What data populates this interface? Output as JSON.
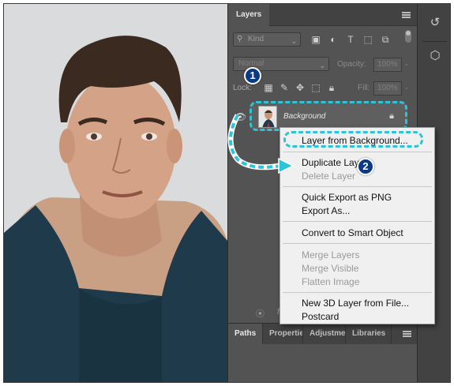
{
  "layers_panel": {
    "tab_label": "Layers",
    "filter": {
      "kind_label": "Kind"
    },
    "blend_mode": "Normal",
    "opacity_label": "Opacity:",
    "opacity_value": "100%",
    "lock_label": "Lock:",
    "fill_label": "Fill:",
    "fill_value": "100%",
    "layer": {
      "name": "Background"
    },
    "footer": {
      "link_glyph": "⦿",
      "fx_label": "fx"
    }
  },
  "bottom_tabs": [
    "Paths",
    "Properties",
    "Adjustments",
    "Libraries"
  ],
  "context_menu": {
    "items": [
      {
        "label": "Layer from Background...",
        "enabled": true
      },
      {
        "label": "Duplicate Layer...",
        "enabled": true
      },
      {
        "label": "Delete Layer",
        "enabled": false
      },
      {
        "label": "Quick Export as PNG",
        "enabled": true
      },
      {
        "label": "Export As...",
        "enabled": true
      },
      {
        "label": "Convert to Smart Object",
        "enabled": true
      },
      {
        "label": "Merge Layers",
        "enabled": false
      },
      {
        "label": "Merge Visible",
        "enabled": false
      },
      {
        "label": "Flatten Image",
        "enabled": false
      },
      {
        "label": "New 3D Layer from File...",
        "enabled": true
      },
      {
        "label": "Postcard",
        "enabled": true
      }
    ]
  },
  "callouts": {
    "step1": "1",
    "step2": "2"
  },
  "colors": {
    "accent_dashed": "#2ec4d8",
    "badge": "#0a3a86",
    "panel": "#535353"
  }
}
